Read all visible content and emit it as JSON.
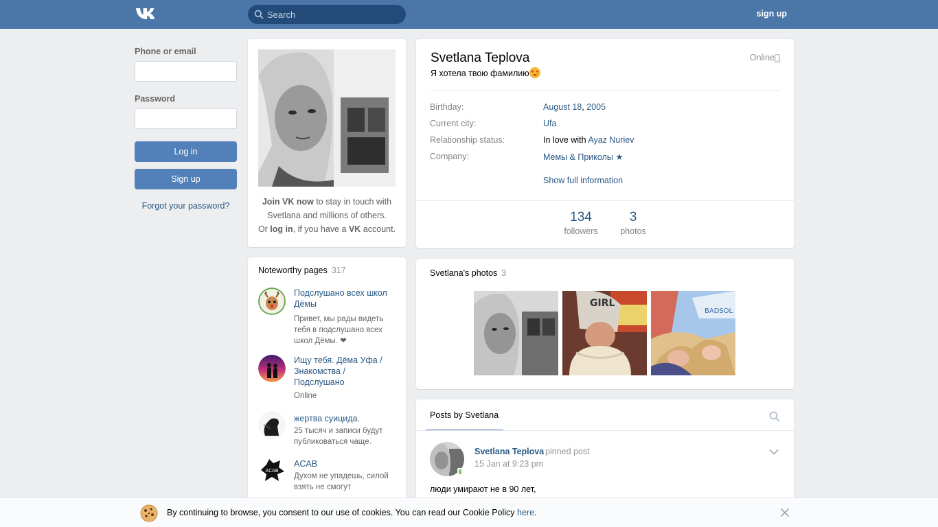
{
  "header": {
    "logo": "VK",
    "search_placeholder": "Search",
    "signup_label": "sign up"
  },
  "login": {
    "phone_label": "Phone or email",
    "password_label": "Password",
    "login_button": "Log in",
    "signup_button": "Sign up",
    "forgot_link": "Forgot your password?"
  },
  "avatar_card": {
    "join_bold": "Join VK now",
    "join_rest": " to stay in touch with Svetlana and millions of others.",
    "or": "Or ",
    "login_bold": "log in",
    "if_have": ", if you have a ",
    "vk_bold": "VK",
    "account": " account."
  },
  "profile": {
    "name": "Svetlana Teplova",
    "online": "Online",
    "status": "Я хотела твою фамилию",
    "birthday_label": "Birthday:",
    "birthday_day": "August 18",
    "birthday_sep": ", ",
    "birthday_year": "2005",
    "city_label": "Current city:",
    "city": "Ufa",
    "relationship_label": "Relationship status:",
    "relationship_prefix": "In love with ",
    "relationship_partner": "Ayaz Nuriev",
    "company_label": "Company:",
    "company": "Мемы & Приколы ★",
    "show_full": "Show full information",
    "followers_count": "134",
    "followers_label": "followers",
    "photos_count": "3",
    "photos_label": "photos"
  },
  "noteworthy": {
    "title": "Noteworthy pages",
    "count": "317",
    "groups": [
      {
        "name": "Подслушано всех школ Дёмы",
        "desc": "Привет, мы рады видеть тебя в подслушано всех школ Дёмы. ❤"
      },
      {
        "name": "Ищу тебя. Дёма Уфа / Знакомства / Подслушано",
        "desc": "Online"
      },
      {
        "name": "жертва суицида.",
        "desc": "25 тысяч и записи будут публиковаться чаще."
      },
      {
        "name": "ACAB",
        "desc": "Духом не упадешь, силой взять не смогут"
      }
    ]
  },
  "photos": {
    "title": "Svetlana's photos",
    "count": "3"
  },
  "posts": {
    "tab": "Posts by Svetlana",
    "author": "Svetlana Teplova",
    "pinned": "pinned post",
    "date": "15 Jan at 9:23 pm",
    "text": "люди умирают не в 90 лет,"
  },
  "cookie": {
    "text": "By continuing to browse, you consent to our use of cookies. You can read our Cookie Policy ",
    "link": "here",
    "end": "."
  },
  "colors": {
    "header": "#4a76a8",
    "accent": "#5181b8",
    "link": "#2a5885"
  }
}
